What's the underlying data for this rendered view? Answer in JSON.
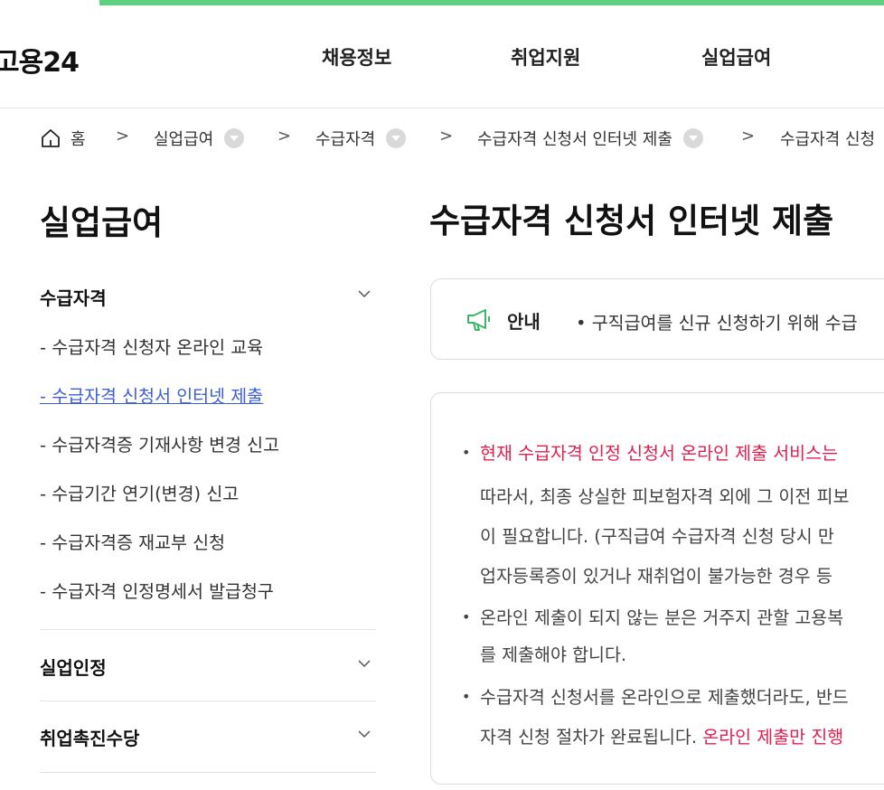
{
  "header": {
    "logo": "고용24",
    "nav": [
      "채용정보",
      "취업지원",
      "실업급여"
    ]
  },
  "breadcrumb": {
    "home": "홈",
    "items": [
      "실업급여",
      "수급자격",
      "수급자격 신청서 인터넷 제출",
      "수급자격 신청"
    ]
  },
  "sidebar": {
    "title": "실업급여",
    "groups": [
      {
        "label": "수급자격",
        "items": [
          "- 수급자격 신청자 온라인 교육",
          "- 수급자격 신청서 인터넷 제출",
          "- 수급자격증 기재사항 변경 신고",
          "- 수급기간 연기(변경) 신고",
          "- 수급자격증 재교부 신청",
          "- 수급자격 인정명세서 발급청구"
        ],
        "active_index": 1
      },
      {
        "label": "실업인정"
      },
      {
        "label": "취업촉진수당"
      }
    ]
  },
  "main": {
    "title": "수급자격 신청서 인터넷 제출",
    "notice": {
      "label": "안내",
      "text": "• 구직급여를 신규 신청하기 위해 수급"
    },
    "content": {
      "line1": "현재 수급자격 인정 신청서 온라인 제출 서비스는",
      "line2": "따라서, 최종 상실한 피보험자격 외에 그 이전 피보",
      "line3": "이 필요합니다. (구직급여 수급자격 신청 당시 만",
      "line4": "업자등록증이 있거나 재취업이 불가능한 경우 등",
      "line5": "온라인 제출이 되지 않는 분은 거주지 관할 고용복",
      "line6": "를 제출해야 합니다.",
      "line7": "수급자격 신청서를 온라인으로 제출했더라도, 반드",
      "line8a": "자격 신청 절차가 완료됩니다. ",
      "line8b": "온라인 제출만 진행"
    }
  },
  "colors": {
    "accent_bar": "#5fcf80",
    "link_active": "#3f5ed8",
    "highlight_red": "#e0204f",
    "notice_icon": "#3bb56a"
  }
}
